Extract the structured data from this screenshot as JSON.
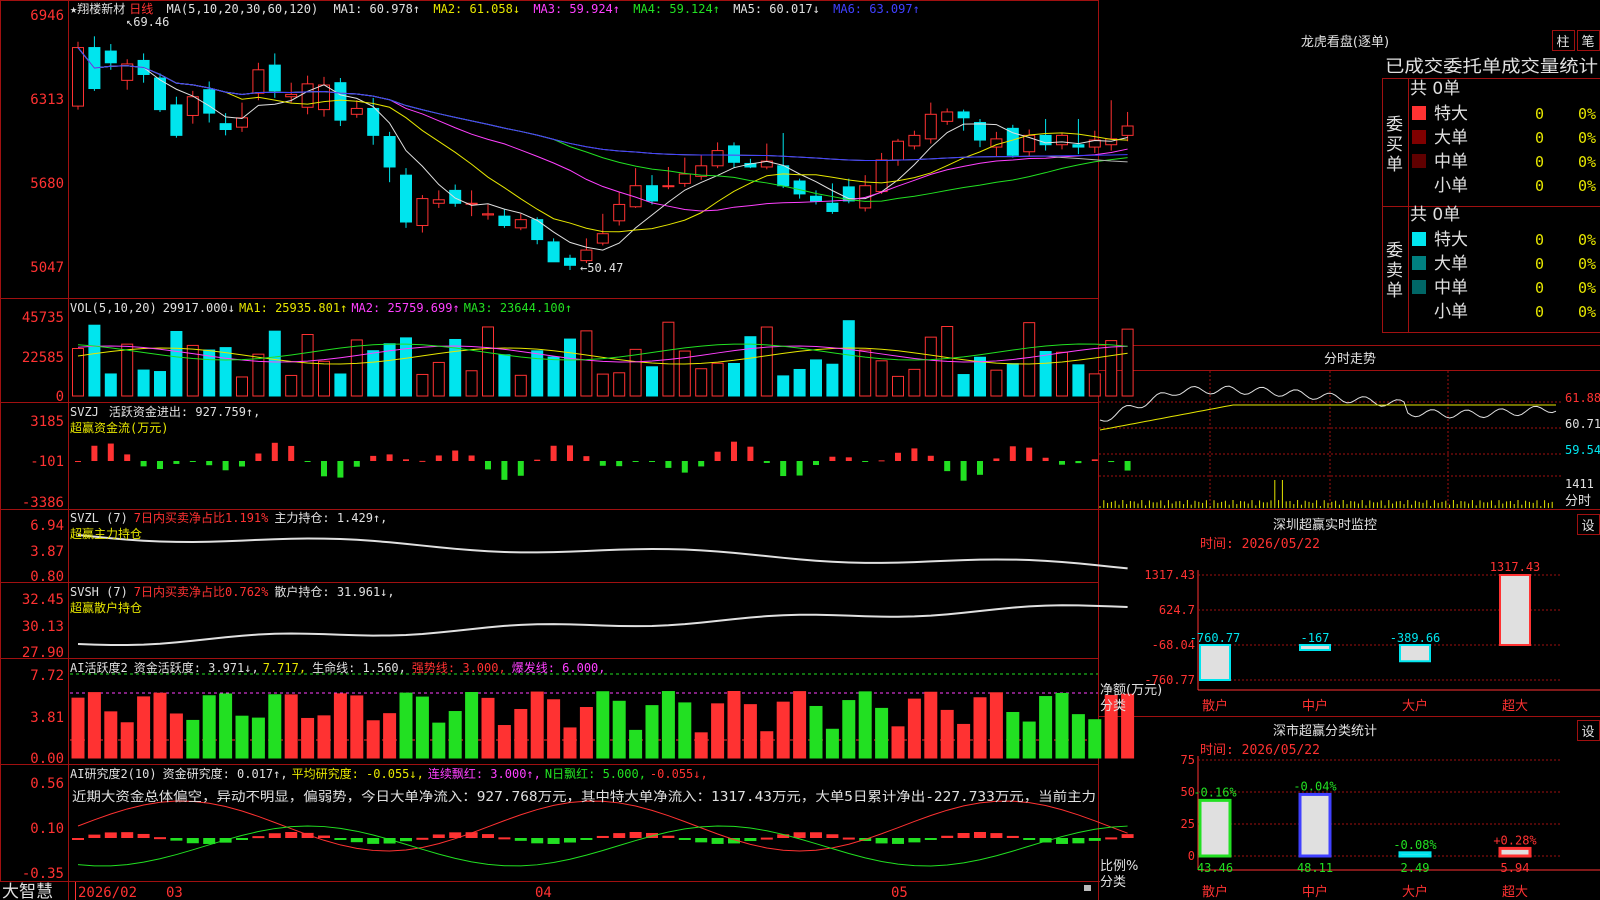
{
  "stock": {
    "name": "★翔楼新材",
    "period": "日线"
  },
  "colors": {
    "up": "#ff3232",
    "down": "#00e5ee",
    "grid": "#a01010",
    "green": "#22e022",
    "white": "#e0e0e0",
    "yellow": "#e6e600",
    "magenta": "#ff40ff",
    "gray": "#b0b0b0",
    "blue": "#4040ff"
  },
  "main": {
    "ma_header": {
      "label": "MA(5,10,20,30,60,120)",
      "ma1": "MA1: 60.978↑",
      "ma2": "MA2: 61.058↓",
      "ma3": "MA3: 59.924↑",
      "ma4": "MA4: 59.124↑",
      "ma5": "MA5: 60.017↓",
      "ma6": "MA6: 63.097↑"
    },
    "y_ticks": [
      "6946",
      "6313",
      "5680",
      "5047"
    ],
    "high_mark": "69.46",
    "low_mark": "←50.47"
  },
  "vol": {
    "header": {
      "label": "VOL(5,10,20)",
      "v": "29917.000↓",
      "ma1": "MA1: 25935.801↑",
      "ma2": "MA2: 25759.699↑",
      "ma3": "MA3: 23644.100↑"
    },
    "y_ticks": [
      "45735",
      "22585",
      "0"
    ]
  },
  "svzj": {
    "header": {
      "label": "SVZJ",
      "a": "活跃资金进出: 927.759↑,",
      "b": "超赢资金流(万元)"
    },
    "y_ticks": [
      "3185",
      "-101",
      "-3386"
    ]
  },
  "svzl": {
    "header": {
      "label": "SVZL (7)",
      "a": "7日内买卖净占比1.191%",
      "b": "主力持仓: 1.429↑,",
      "c": "超赢主力持仓"
    },
    "y_ticks": [
      "6.94",
      "3.87",
      "0.80"
    ]
  },
  "svsh": {
    "header": {
      "label": "SVSH (7)",
      "a": "7日内买卖净占比0.762%",
      "b": "散户持仓: 31.961↓,",
      "c": "超赢散户持仓"
    },
    "y_ticks": [
      "32.45",
      "30.13",
      "27.90"
    ]
  },
  "ai1": {
    "header": {
      "label": "AI活跃度2",
      "a": "资金活跃度: 3.971↓,",
      "b": "7.717,",
      "c": "生命线: 1.560,",
      "d": "强势线: 3.000,",
      "e": "爆发线: 6.000,"
    },
    "y_ticks": [
      "7.72",
      "3.81",
      "0.00"
    ]
  },
  "ai2": {
    "header": {
      "label": "AI研究度2(10)",
      "a": "资金研究度: 0.017↑,",
      "b": "平均研究度: -0.055↓,",
      "c": "连续飘红: 3.000↑,",
      "d": "N日飘红: 5.000,",
      "e": "-0.055↓,"
    },
    "comment": "近期大资金总体偏空，异动不明显，偏弱势，今日大单净流入：927.768万元，其中特大单净流入：1317.43万元，大单5日累计净出-227.733万元，当前主力",
    "y_ticks": [
      "0.56",
      "0.10",
      "-0.35"
    ]
  },
  "bottom": {
    "logo": "大智慧",
    "dates": [
      "2026/02",
      "03",
      "04",
      "05"
    ]
  },
  "right": {
    "lhkp_title": "龙虎看盘(逐单)",
    "btn1": "柱",
    "btn2": "笔",
    "stats_title": "已成交委托单成交量统计",
    "buy": {
      "label": "委买单",
      "total": "共 0单",
      "rows": [
        {
          "name": "特大",
          "v": "0",
          "p": "0%"
        },
        {
          "name": "大单",
          "v": "0",
          "p": "0%"
        },
        {
          "name": "中单",
          "v": "0",
          "p": "0%"
        },
        {
          "name": "小单",
          "v": "0",
          "p": "0%"
        }
      ]
    },
    "sell": {
      "label": "委卖单",
      "total": "共 0单",
      "rows": [
        {
          "name": "特大",
          "v": "0",
          "p": "0%"
        },
        {
          "name": "大单",
          "v": "0",
          "p": "0%"
        },
        {
          "name": "中单",
          "v": "0",
          "p": "0%"
        },
        {
          "name": "小单",
          "v": "0",
          "p": "0%"
        }
      ]
    },
    "intraday": {
      "title": "分时走势",
      "y_ticks": [
        "61.88",
        "60.71",
        "59.54"
      ],
      "vol_tick": "1411",
      "vol_label": "分时"
    },
    "monitor": {
      "title": "深圳超赢实时监控",
      "btn": "设",
      "time": "时间: 2026/05/22",
      "y_ticks": [
        "1317.43",
        "624.7",
        "-68.04",
        "-760.77"
      ],
      "axis_label1": "净额(万元)",
      "axis_label2": "分类",
      "cats": [
        "散户",
        "中户",
        "大户",
        "超大"
      ],
      "values": [
        -760.77,
        -167,
        -389.66,
        1317.43
      ],
      "labels": [
        "-760.77",
        "-167",
        "-389.66",
        "1317.43"
      ]
    },
    "classify": {
      "title": "深市超赢分类统计",
      "btn": "设",
      "time": "时间: 2026/05/22",
      "y_ticks": [
        "75",
        "50",
        "25",
        "0"
      ],
      "axis_label1": "比例%",
      "axis_label2": "分类",
      "cats": [
        "散户",
        "中户",
        "大户",
        "超大"
      ],
      "values": [
        43.46,
        48.11,
        2.49,
        5.94
      ],
      "changes": [
        "-0.16%",
        "-0.04%",
        "-0.08%",
        "+0.28%"
      ],
      "value_labels": [
        "43.46",
        "48.11",
        "2.49",
        "5.94"
      ]
    }
  },
  "chart_data": {
    "type": "candlestick",
    "y_range": [
      47.0,
      70.0
    ],
    "candles": [
      [
        63.5,
        68.5,
        69.0,
        63.2
      ],
      [
        68.5,
        65.0,
        69.46,
        64.8
      ],
      [
        68.2,
        67.2,
        68.8,
        66.6
      ],
      [
        65.7,
        67.1,
        67.5,
        64.9
      ],
      [
        67.4,
        66.2,
        68.0,
        65.5
      ],
      [
        65.9,
        63.2,
        66.3,
        63.0
      ],
      [
        63.6,
        61.0,
        64.3,
        60.8
      ],
      [
        62.7,
        64.3,
        64.8,
        62.0
      ],
      [
        64.9,
        62.9,
        65.6,
        62.1
      ],
      [
        62.0,
        61.5,
        62.9,
        61.0
      ],
      [
        61.7,
        62.5,
        63.8,
        61.3
      ],
      [
        64.6,
        66.6,
        67.2,
        64.0
      ],
      [
        67.0,
        64.8,
        68.0,
        64.2
      ],
      [
        64.3,
        64.5,
        65.5,
        63.8
      ],
      [
        63.4,
        65.4,
        66.1,
        62.8
      ],
      [
        63.2,
        65.3,
        66.0,
        62.6
      ],
      [
        65.5,
        62.3,
        65.9,
        61.8
      ],
      [
        62.8,
        63.3,
        64.0,
        62.5
      ],
      [
        63.3,
        61.0,
        64.2,
        60.2
      ],
      [
        60.9,
        58.3,
        61.3,
        57.0
      ],
      [
        57.6,
        53.6,
        58.2,
        53.1
      ],
      [
        53.3,
        55.6,
        55.9,
        52.7
      ],
      [
        55.2,
        55.5,
        56.3,
        54.8
      ],
      [
        56.3,
        55.2,
        56.8,
        54.9
      ],
      [
        55.2,
        55.2,
        56.3,
        54.1
      ],
      [
        54.2,
        54.3,
        55.1,
        53.8
      ],
      [
        54.1,
        53.3,
        54.7,
        53.1
      ],
      [
        53.1,
        53.8,
        54.3,
        52.9
      ],
      [
        53.8,
        52.1,
        54.0,
        51.7
      ],
      [
        51.9,
        50.2,
        52.2,
        50.47
      ],
      [
        50.5,
        49.9,
        50.8,
        49.5
      ],
      [
        50.3,
        51.2,
        52.2,
        50.1
      ],
      [
        51.8,
        52.6,
        54.3,
        51.6
      ],
      [
        53.7,
        55.1,
        56.2,
        53.3
      ],
      [
        54.9,
        56.7,
        58.2,
        54.8
      ],
      [
        56.7,
        55.4,
        57.6,
        55.1
      ],
      [
        56.7,
        56.7,
        58.3,
        56.4
      ],
      [
        56.9,
        57.7,
        59.1,
        56.6
      ],
      [
        57.5,
        58.4,
        59.3,
        57.2
      ],
      [
        58.4,
        59.7,
        60.4,
        58.2
      ],
      [
        60.1,
        58.7,
        60.4,
        58.2
      ],
      [
        58.6,
        58.3,
        59.0,
        58.2
      ],
      [
        58.3,
        58.8,
        60.3,
        58.1
      ],
      [
        58.4,
        56.7,
        61.2,
        56.5
      ],
      [
        57.1,
        56.0,
        57.3,
        55.6
      ],
      [
        55.8,
        55.4,
        56.3,
        55.1
      ],
      [
        55.2,
        54.5,
        56.9,
        54.3
      ],
      [
        56.6,
        55.4,
        57.3,
        55.2
      ],
      [
        54.8,
        56.7,
        57.6,
        54.5
      ],
      [
        56.2,
        58.9,
        59.5,
        56.0
      ],
      [
        58.9,
        60.5,
        60.7,
        58.4
      ],
      [
        60.1,
        61.0,
        61.4,
        59.8
      ],
      [
        60.7,
        62.8,
        63.8,
        60.3
      ],
      [
        62.2,
        63.0,
        63.3,
        61.9
      ],
      [
        63.0,
        62.5,
        63.2,
        61.4
      ],
      [
        62.1,
        60.6,
        62.4,
        60.0
      ],
      [
        60.0,
        60.7,
        61.3,
        59.2
      ],
      [
        61.6,
        59.3,
        61.9,
        59.1
      ],
      [
        59.6,
        61.0,
        61.5,
        59.2
      ],
      [
        61.0,
        60.2,
        62.4,
        59.7
      ],
      [
        60.2,
        61.0,
        61.2,
        59.8
      ],
      [
        60.2,
        60.0,
        62.4,
        59.4
      ],
      [
        60.0,
        60.6,
        61.4,
        59.5
      ],
      [
        60.2,
        60.7,
        64.0,
        59.7
      ],
      [
        61.0,
        61.8,
        63.0,
        60.5
      ]
    ]
  }
}
